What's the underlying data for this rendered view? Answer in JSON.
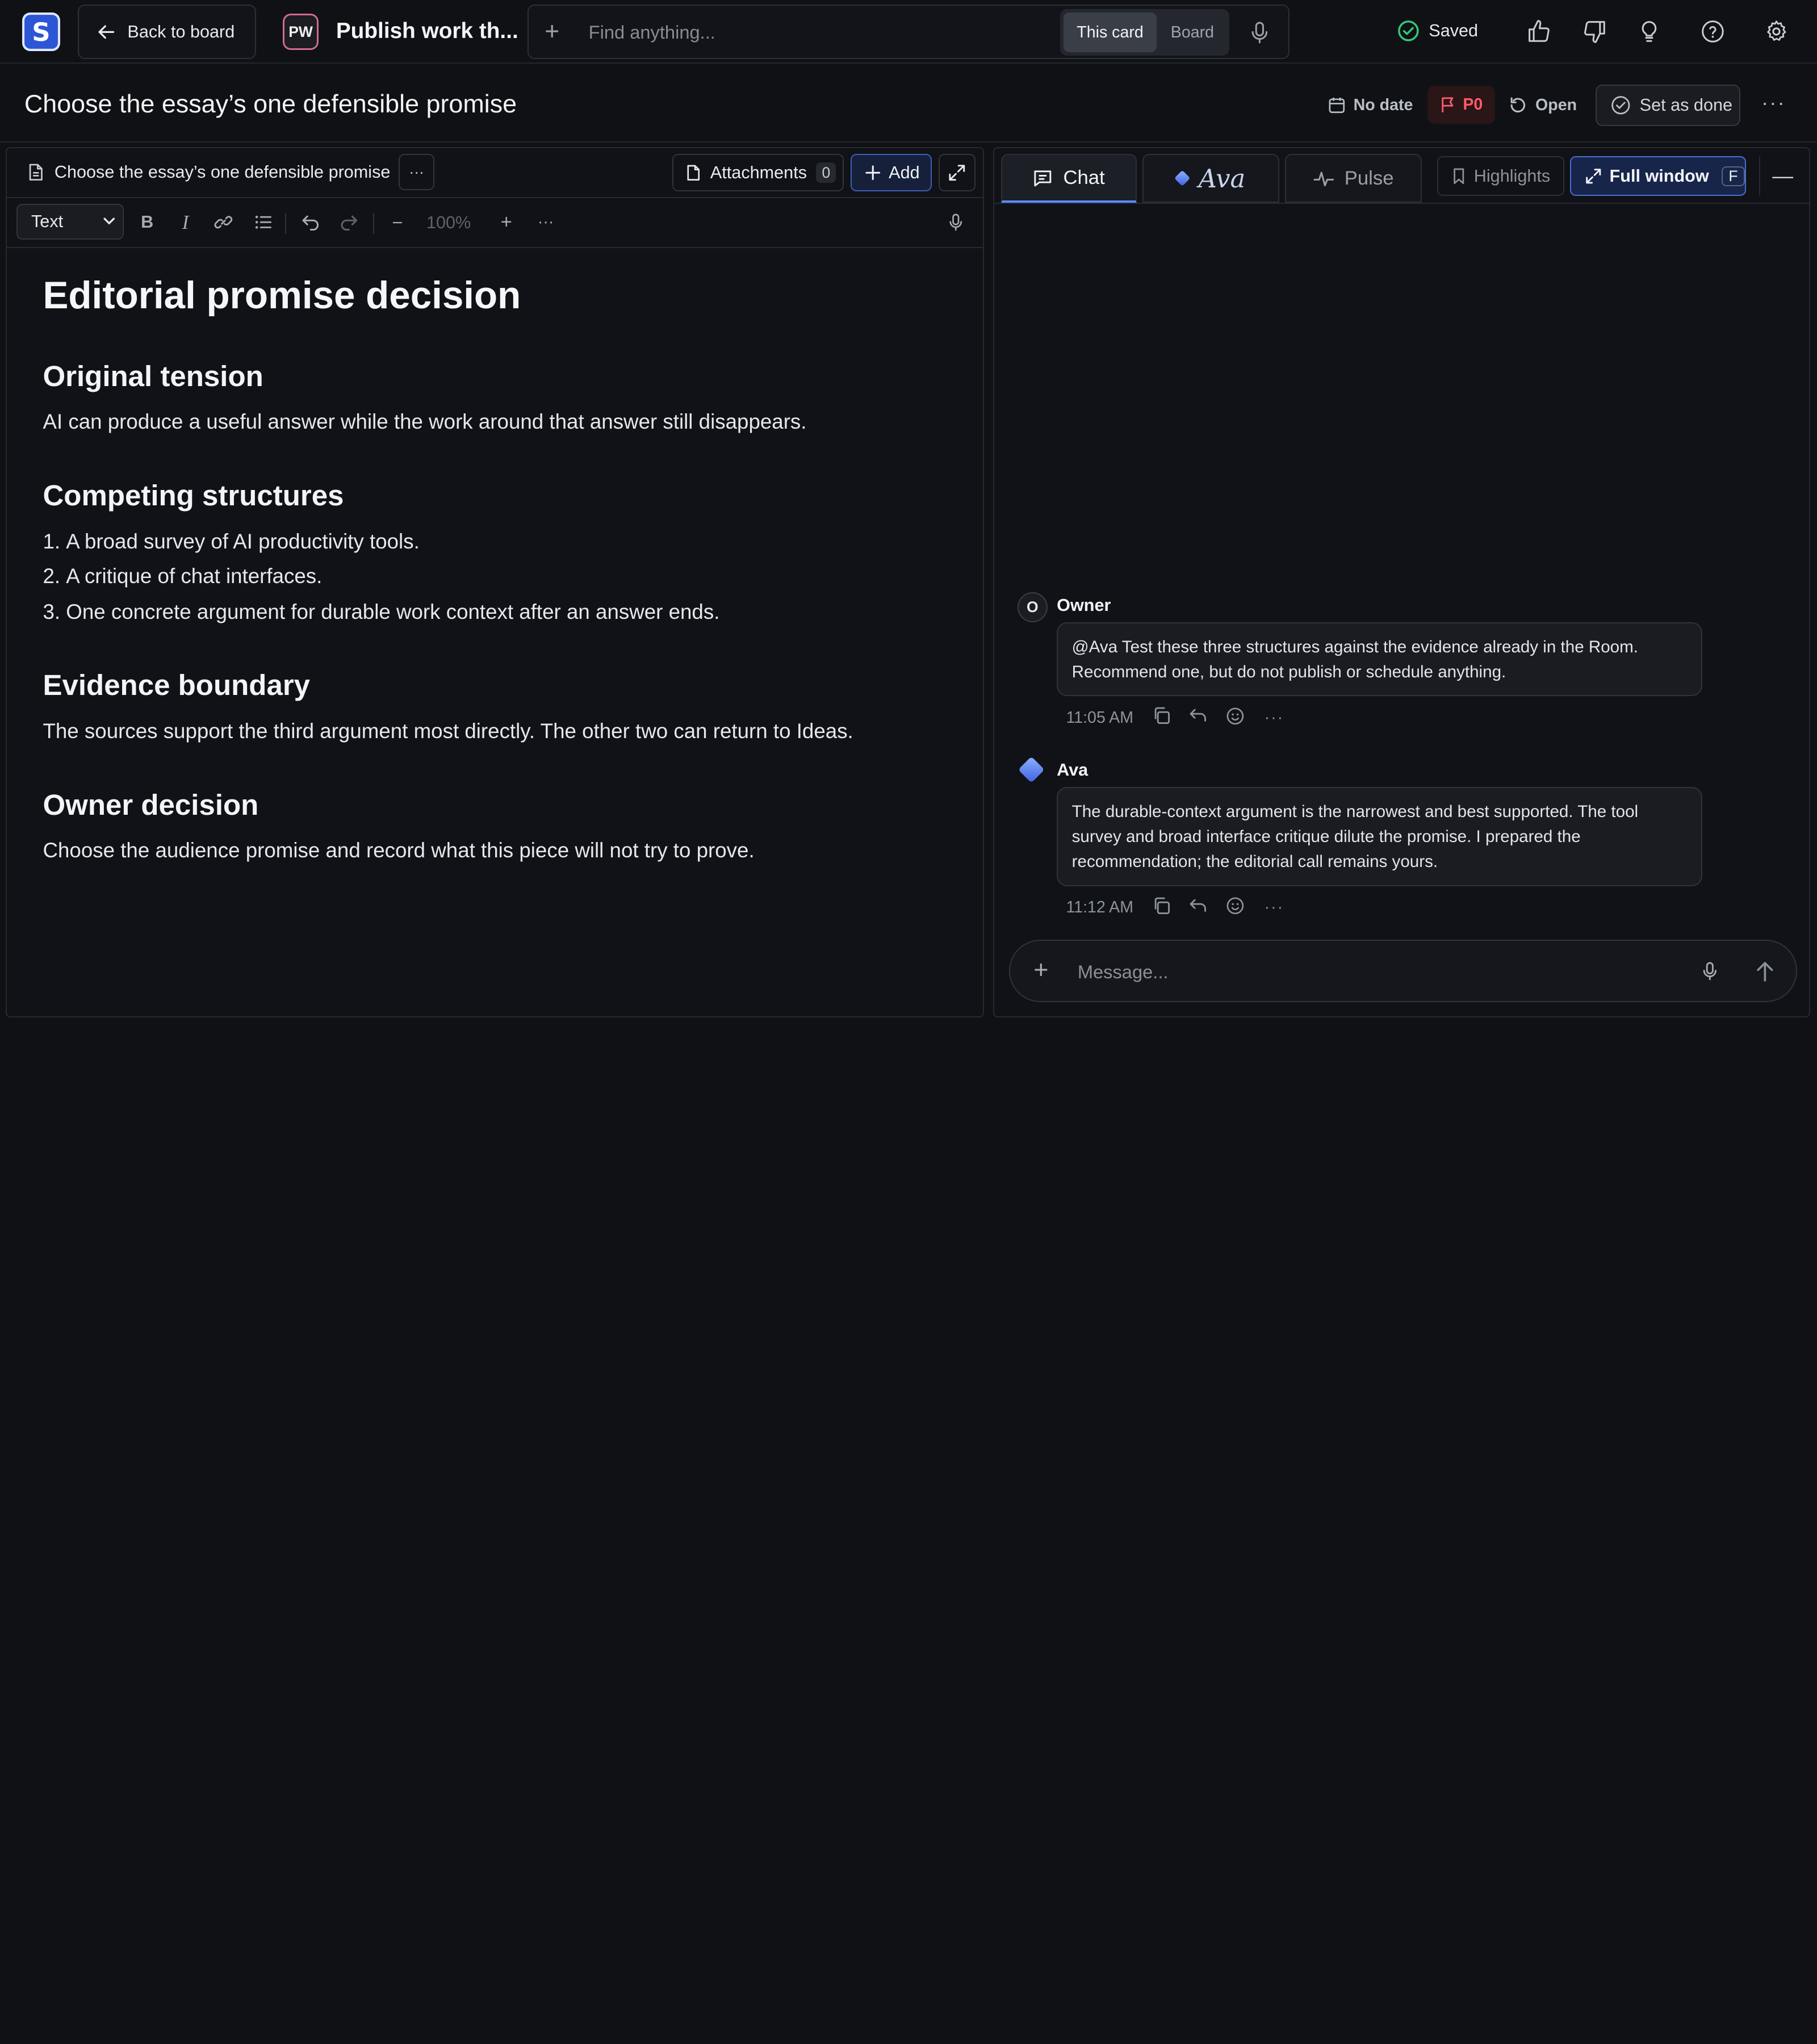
{
  "topbar": {
    "logo_letter": "S",
    "back_label": "Back to board",
    "board_badge": "PW",
    "board_title": "Publish work th...",
    "search_placeholder": "Find anything...",
    "scope_options": [
      "This card",
      "Board"
    ],
    "scope_selected": "This card",
    "save_status": "Saved"
  },
  "card": {
    "title": "Choose the essay’s one defensible promise",
    "date_label": "No date",
    "priority": "P0",
    "status": "Open",
    "done_label": "Set as done"
  },
  "editor": {
    "doc_name": "Choose the essay’s one defensible promise",
    "attachments_label": "Attachments",
    "attachments_count": "0",
    "add_label": "Add",
    "block_style": "Text",
    "zoom": "100%",
    "content": {
      "heading": "Editorial promise decision",
      "sections": [
        {
          "title": "Original tension",
          "text": "AI can produce a useful answer while the work around that answer still disappears."
        },
        {
          "title": "Competing structures",
          "items": [
            "A broad survey of AI productivity tools.",
            "A critique of chat interfaces.",
            "One concrete argument for durable work context after an answer ends."
          ]
        },
        {
          "title": "Evidence boundary",
          "text": "The sources support the third argument most directly. The other two can return to Ideas."
        },
        {
          "title": "Owner decision",
          "text": "Choose the audience promise and record what this piece will not try to prove."
        }
      ]
    }
  },
  "chat": {
    "tabs": {
      "chat": "Chat",
      "ava": "Ava",
      "pulse": "Pulse"
    },
    "highlights_label": "Highlights",
    "full_window_label": "Full window",
    "full_window_key": "F",
    "messages": [
      {
        "author": "Owner",
        "initial": "O",
        "text": "@Ava Test these three structures against the evidence already in the Room. Recommend one, but do not publish or schedule anything.",
        "time": "11:05 AM"
      },
      {
        "author": "Ava",
        "text": "The durable-context argument is the narrowest and best supported. The tool survey and broad interface critique dilute the promise. I prepared the recommendation; the editorial call remains yours.",
        "time": "11:12 AM"
      }
    ],
    "composer_placeholder": "Message..."
  },
  "colors": {
    "background": "#0f1115",
    "accent": "#5b8cff",
    "priority": "#ff5a6a",
    "saved": "#34c77b"
  },
  "icons": [
    "app-logo-icon",
    "arrow-left-icon",
    "plus-icon",
    "microphone-icon",
    "check-circle-icon",
    "thumbs-up-icon",
    "thumbs-down-icon",
    "lightbulb-icon",
    "help-icon",
    "gear-icon",
    "calendar-icon",
    "flag-icon",
    "refresh-icon",
    "more-icon",
    "document-icon",
    "expand-icon",
    "bold-icon",
    "italic-icon",
    "link-icon",
    "list-icon",
    "undo-icon",
    "redo-icon",
    "chat-icon",
    "pulse-icon",
    "bookmark-icon",
    "copy-icon",
    "reply-icon",
    "emoji-icon",
    "send-icon"
  ]
}
